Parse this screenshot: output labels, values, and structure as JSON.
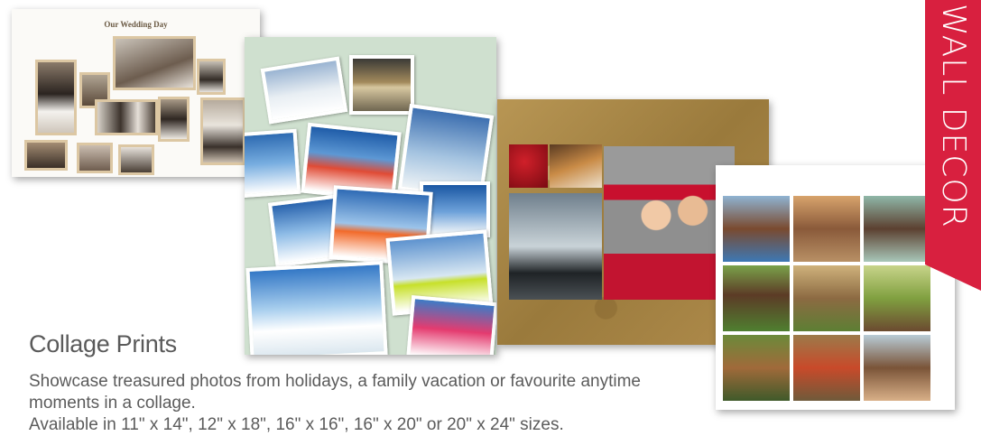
{
  "ribbon": {
    "label": "WALL DECOR",
    "color": "#d8203f"
  },
  "collage_wedding": {
    "title": "Our Wedding Day"
  },
  "product": {
    "heading": "Collage Prints",
    "description": "Showcase treasured photos from holidays, a family vacation or favourite anytime moments in a collage.",
    "sizes": "Available in 11\" x 14\", 12\" x 18\", 16\" x 16\", 16\" x  20\" or 20\" x 24\" sizes."
  }
}
